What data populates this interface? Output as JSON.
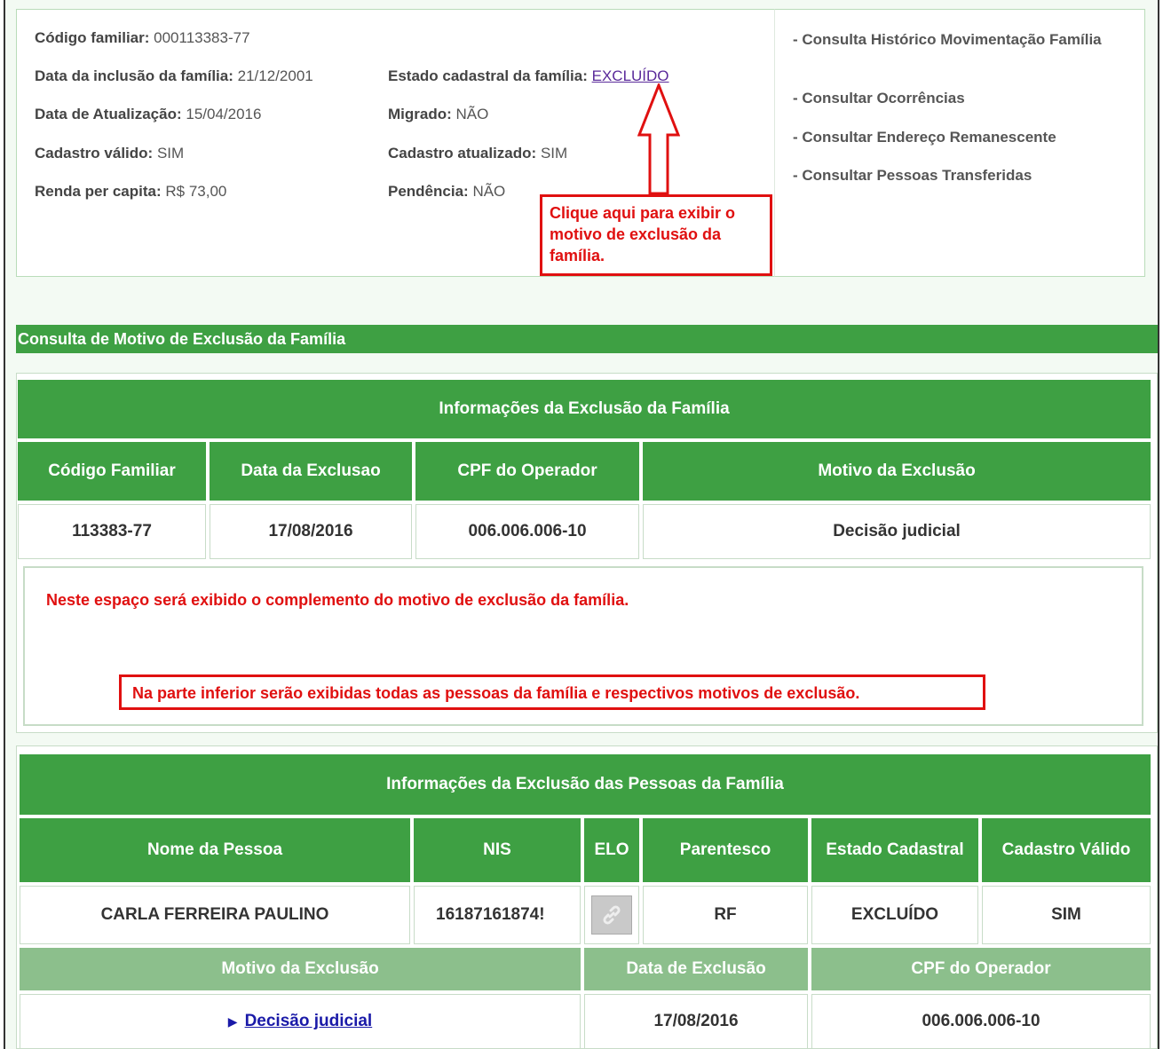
{
  "family": {
    "codigo_label": "Código familiar:",
    "codigo_value": "000113383-77",
    "inclusao_label": "Data da inclusão da família:",
    "inclusao_value": "21/12/2001",
    "atualizacao_label": "Data de Atualização:",
    "atualizacao_value": "15/04/2016",
    "valido_label": "Cadastro válido:",
    "valido_value": "SIM",
    "renda_label": "Renda per capita:",
    "renda_value": "R$ 73,00",
    "estado_label": "Estado cadastral da família:",
    "estado_value": "EXCLUÍDO",
    "migrado_label": "Migrado:",
    "migrado_value": "NÃO",
    "atualizado_label": "Cadastro atualizado:",
    "atualizado_value": "SIM",
    "pendencia_label": "Pendência:",
    "pendencia_value": "NÃO"
  },
  "side_links": [
    "- Consulta Histórico Movimentação Família",
    "- Consultar Ocorrências",
    "- Consultar Endereço Remanescente",
    "- Consultar Pessoas Transferidas"
  ],
  "callout_top": "Clique aqui para exibir o motivo de exclusão da família.",
  "section_title": "Consulta de Motivo de Exclusão da Família",
  "family_exclusion": {
    "title": "Informações da Exclusão da Família",
    "headers": [
      "Código Familiar",
      "Data da Exclusao",
      "CPF do Operador",
      "Motivo da Exclusão"
    ],
    "row": [
      "113383-77",
      "17/08/2016",
      "006.006.006-10",
      "Decisão judicial"
    ],
    "complement_note": "Neste espaço será exibido o complemento do motivo de exclusão  da família.",
    "lower_note": "Na parte inferior serão exibidas todas as pessoas da família e respectivos motivos de exclusão."
  },
  "people_exclusion": {
    "title": "Informações da Exclusão das Pessoas da Família",
    "headers": [
      "Nome da Pessoa",
      "NIS",
      "ELO",
      "Parentesco",
      "Estado Cadastral",
      "Cadastro Válido"
    ],
    "row": [
      "CARLA FERREIRA PAULINO",
      "16187161874!",
      "",
      "RF",
      "EXCLUÍDO",
      "SIM"
    ],
    "sub_headers": [
      "Motivo da Exclusão",
      "Data de Exclusão",
      "CPF do Operador"
    ],
    "sub_row": [
      "Decisão judicial",
      "17/08/2016",
      "006.006.006-10"
    ]
  },
  "colors": {
    "header_green": "#3ea043",
    "light_green": "#8cbf8c",
    "callout_red": "#e01010"
  }
}
